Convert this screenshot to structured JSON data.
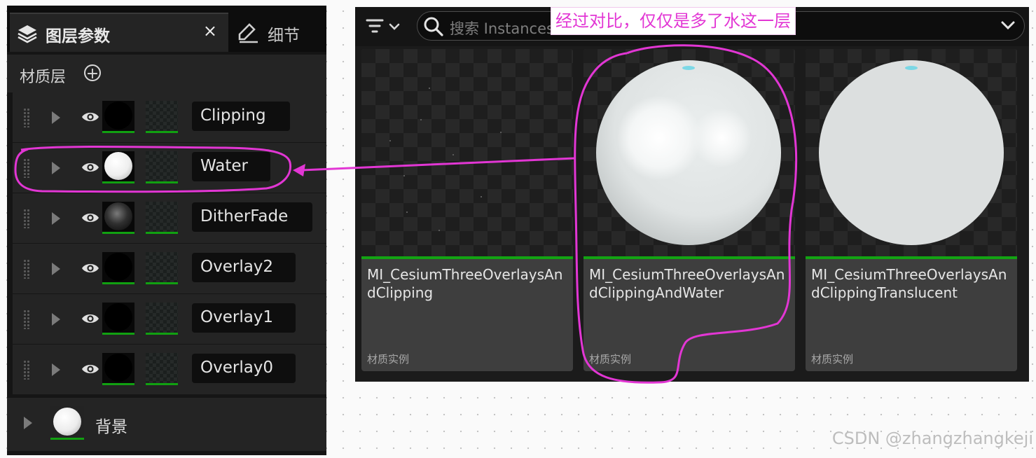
{
  "left_panel": {
    "tab_layer_params": {
      "label": "图层参数",
      "close": "×"
    },
    "tab_details": {
      "label": "细节"
    },
    "section_title": "材质层",
    "layers": [
      {
        "name": "Clipping",
        "thumb": "black"
      },
      {
        "name": "Water",
        "thumb": "water"
      },
      {
        "name": "DitherFade",
        "thumb": "dither"
      },
      {
        "name": "Overlay2",
        "thumb": "black"
      },
      {
        "name": "Overlay1",
        "thumb": "black"
      },
      {
        "name": "Overlay0",
        "thumb": "black"
      }
    ],
    "background_label": "背景"
  },
  "right_panel": {
    "search_placeholder": "搜索 Instances",
    "cards": [
      {
        "name": "MI_CesiumThreeOverlaysAndClipping",
        "kind": "材质实例",
        "preview": "empty"
      },
      {
        "name": "MI_CesiumThreeOverlaysAndClippingAndWater",
        "kind": "材质实例",
        "preview": "shaded-sphere"
      },
      {
        "name": "MI_CesiumThreeOverlaysAndClippingTranslucent",
        "kind": "材质实例",
        "preview": "flat-sphere"
      }
    ]
  },
  "annotation": {
    "text": "经过对比，仅仅是多了水这一层",
    "color": "#e236d4"
  },
  "watermark": "CSDN @zhangzhangkeji",
  "colors": {
    "panel_bg": "#151515",
    "row_bg": "#242424",
    "card_bg": "#3e3e3e",
    "green_bar": "#13a313",
    "highlight": "#e236d4"
  },
  "icons": [
    "layers-icon",
    "close-icon",
    "edit-details-icon",
    "add-circle-icon",
    "drag-handle-icon",
    "expand-arrow-icon",
    "eye-icon",
    "filter-icon",
    "search-icon",
    "chevron-down-icon"
  ]
}
